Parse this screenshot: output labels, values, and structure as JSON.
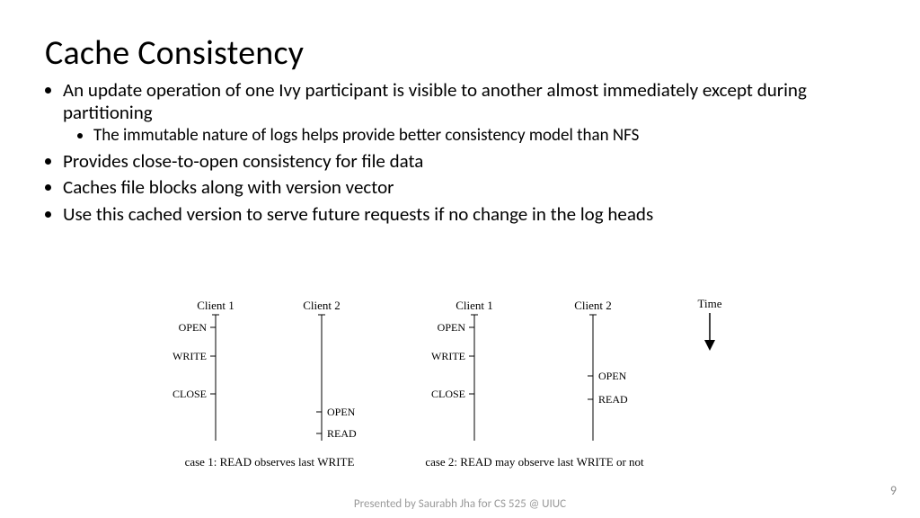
{
  "title": "Cache Consistency",
  "bullets": {
    "b1": "An update operation of one Ivy participant is visible to another almost immediately except during partitioning",
    "b1a": "The immutable nature of logs helps provide better consistency model than NFS",
    "b2": "Provides close-to-open consistency for file data",
    "b3": "Caches file blocks along with version vector",
    "b4": "Use this cached version to serve future requests if no change in the log heads"
  },
  "diagram": {
    "client1": "Client 1",
    "client2": "Client 2",
    "open": "OPEN",
    "write": "WRITE",
    "close": "CLOSE",
    "read": "READ",
    "time": "Time",
    "case1_prefix": "case 1: ",
    "case1_read": "READ",
    "case1_mid": " observes last ",
    "case1_write": "WRITE",
    "case2_prefix": "case 2: ",
    "case2_read": "READ",
    "case2_mid": " may observe last ",
    "case2_write": "WRITE",
    "case2_suffix": " or not"
  },
  "footer": "Presented by Saurabh Jha for CS 525 @ UIUC",
  "pagenum": "9"
}
